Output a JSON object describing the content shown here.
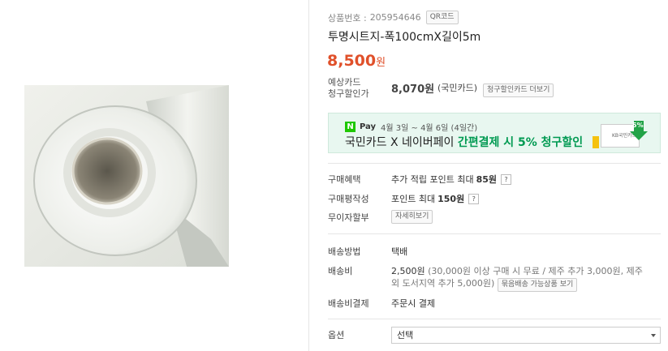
{
  "product": {
    "id_label": "상품번호 :",
    "id_value": "205954646",
    "qr_label": "QR코드",
    "title": "투명시트지-폭100cmX길이5m",
    "price": "8,500",
    "price_unit": "원"
  },
  "card_discount": {
    "label_line1": "예상카드",
    "label_line2": "청구할인가",
    "price": "8,070원",
    "card_name": "(국민카드)",
    "more_button": "청구할인카드 더보기"
  },
  "banner": {
    "badge": "N",
    "brand": "Pay",
    "dates": "4월 3일 ~ 4월 6일 (4일간)",
    "text_plain": "국민카드 X 네이버페이 ",
    "text_highlight": "간편결제 시 5% 청구할인",
    "card_text": "KB국민카드",
    "percent": "5%",
    "colors": {
      "accent": "#009a52",
      "background": "#e8f7f0",
      "badge": "#1ec800"
    }
  },
  "benefits": {
    "purchase_label": "구매혜택",
    "purchase_text": "추가 적립 포인트 최대",
    "purchase_value": "85원",
    "review_label": "구매평작성",
    "review_text": "포인트 최대",
    "review_value": "150원",
    "qmark": "?",
    "installment_label": "무이자할부",
    "installment_button": "자세히보기"
  },
  "shipping": {
    "method_label": "배송방법",
    "method_value": "택배",
    "fee_label": "배송비",
    "fee_value": "2,500원",
    "fee_detail_line1": "(30,000원 이상 구매 시 무료 / 제주 추가 3,000원, 제주",
    "fee_detail_line2": "외 도서지역 추가 5,000원)",
    "bundle_button": "묶음배송 가능상품 보기",
    "payment_label": "배송비결제",
    "payment_value": "주문시 결제"
  },
  "option": {
    "label": "옵션",
    "selected": "선택"
  },
  "colors": {
    "price": "#e0502a"
  }
}
